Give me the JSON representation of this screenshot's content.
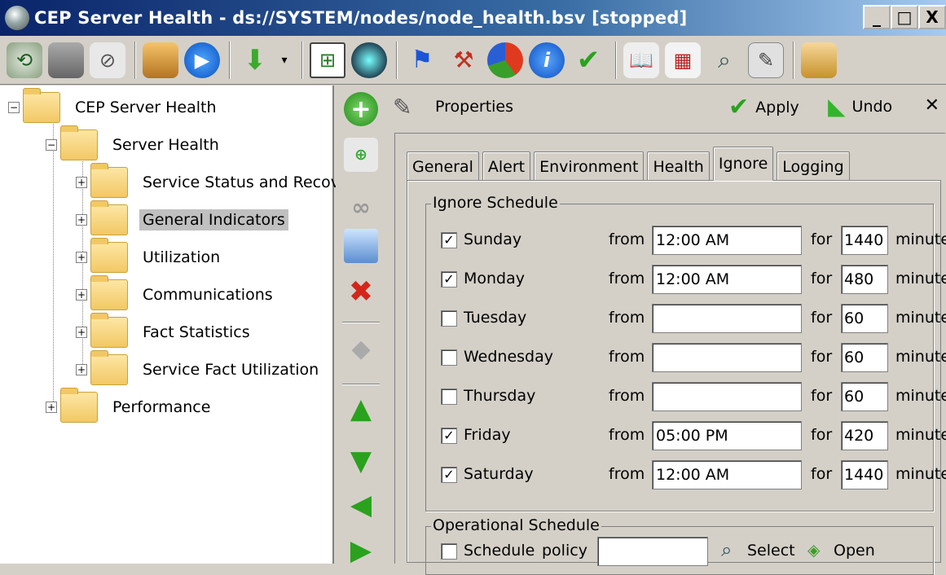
{
  "window": {
    "title": "CEP Server Health - ds://SYSTEM/nodes/node_health.bsv [stopped]",
    "minimize": "_",
    "maximize": "□",
    "close": "X"
  },
  "toolbar": {
    "icons": [
      "back-icon",
      "save-icon",
      "attach-icon",
      "package-icon",
      "play-icon",
      "download-icon",
      "dropdown-arrow-icon",
      "tree-icon",
      "globe-icon",
      "flag-icon",
      "tools-icon",
      "pie-chart-icon",
      "info-icon",
      "check-icon",
      "book-icon",
      "calendar-icon",
      "search-icon",
      "wrench-icon",
      "lock-icon"
    ]
  },
  "tree": {
    "root": "CEP Server Health",
    "group": "Server Health",
    "items": [
      "Service Status and Recov",
      "General Indicators",
      "Utilization",
      "Communications",
      "Fact Statistics",
      "Service Fact Utilization"
    ],
    "selected": "General Indicators",
    "sibling": "Performance",
    "expander_collapsed": "+",
    "expander_expanded": "−"
  },
  "properties": {
    "title": "Properties",
    "apply_label": "Apply",
    "undo_label": "Undo",
    "close_label": "✕"
  },
  "tabs": [
    {
      "label": "General",
      "active": false
    },
    {
      "label": "Alert",
      "active": false
    },
    {
      "label": "Environment",
      "active": false
    },
    {
      "label": "Health",
      "active": false
    },
    {
      "label": "Ignore",
      "active": true
    },
    {
      "label": "Logging",
      "active": false
    }
  ],
  "ignore_schedule": {
    "label": "Ignore Schedule",
    "from_label": "from",
    "for_label": "for",
    "minutes_label": "minutes",
    "rows": [
      {
        "day": "Sunday",
        "checked": true,
        "from": "12:00 AM",
        "for": "1440"
      },
      {
        "day": "Monday",
        "checked": true,
        "from": "12:00 AM",
        "for": "480"
      },
      {
        "day": "Tuesday",
        "checked": false,
        "from": "",
        "for": "60"
      },
      {
        "day": "Wednesday",
        "checked": false,
        "from": "",
        "for": "60"
      },
      {
        "day": "Thursday",
        "checked": false,
        "from": "",
        "for": "60"
      },
      {
        "day": "Friday",
        "checked": true,
        "from": "05:00 PM",
        "for": "420"
      },
      {
        "day": "Saturday",
        "checked": true,
        "from": "12:00 AM",
        "for": "1440"
      }
    ]
  },
  "operational_schedule": {
    "label": "Operational Schedule",
    "schedule_label": "Schedule",
    "policy_label": "policy",
    "policy_value": "",
    "select_label": "Select",
    "open_label": "Open"
  },
  "check_mark": "✓"
}
